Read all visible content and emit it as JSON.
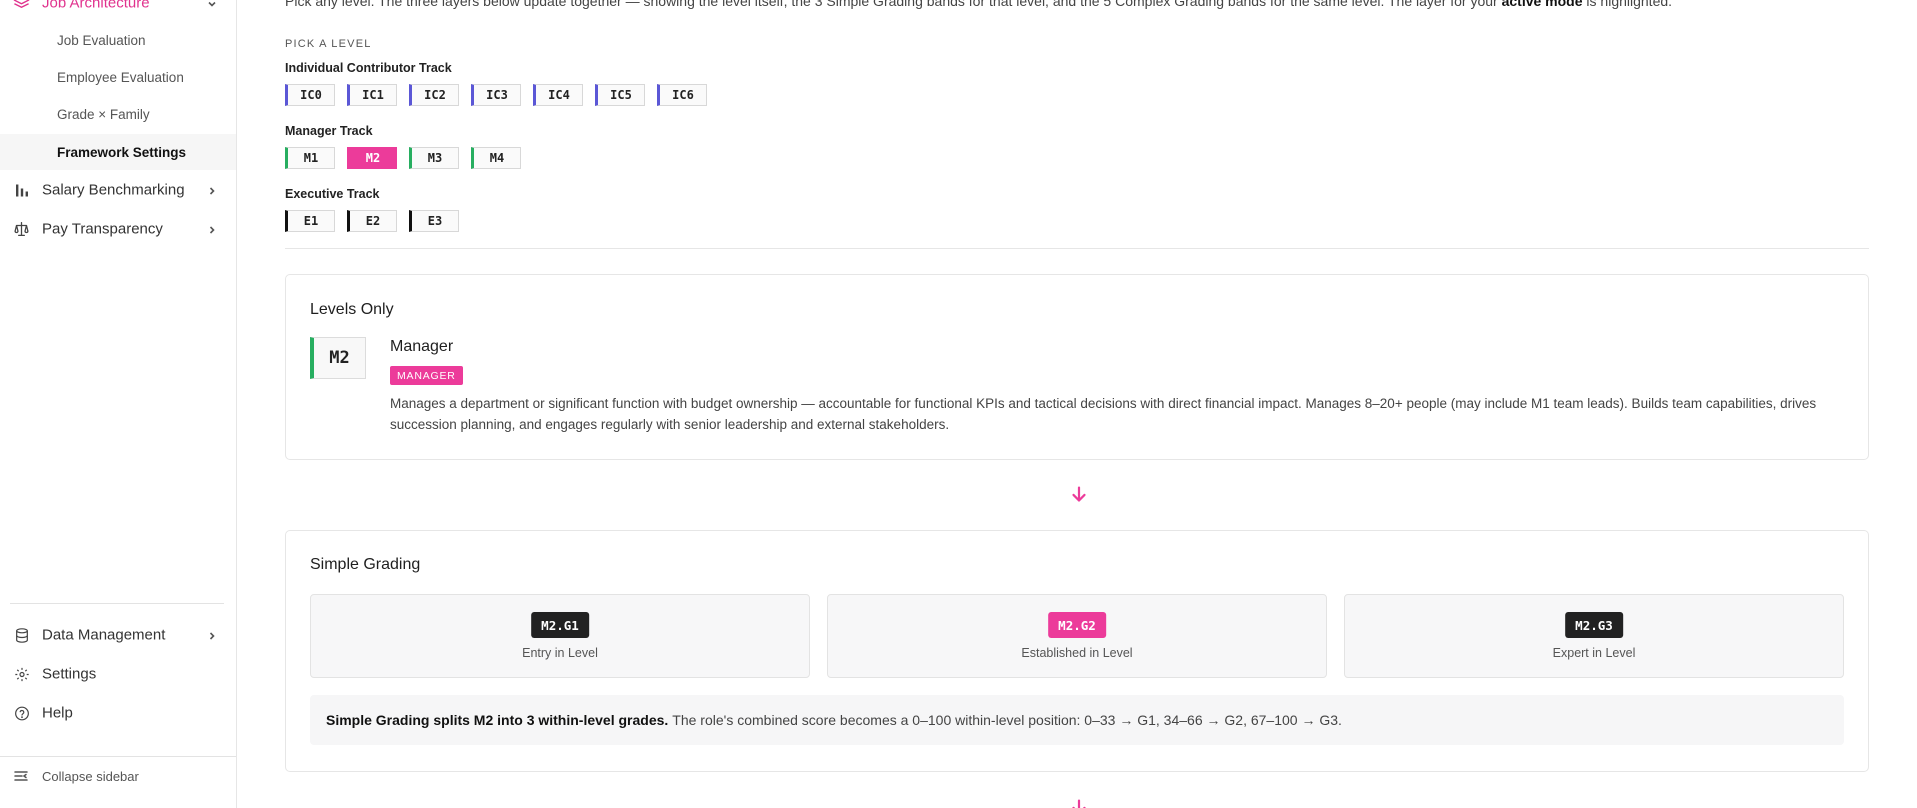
{
  "sidebar": {
    "job_architecture": "Job Architecture",
    "sub_items": [
      "Job Evaluation",
      "Employee Evaluation",
      "Grade × Family",
      "Framework Settings"
    ],
    "salary_benchmarking": "Salary Benchmarking",
    "pay_transparency": "Pay Transparency",
    "data_management": "Data Management",
    "settings": "Settings",
    "help": "Help",
    "collapse": "Collapse sidebar",
    "accent_color": "#e0338e"
  },
  "main": {
    "intro_start": "Pick any level. The three layers below update together — showing the level itself, the 3 Simple Grading bands for that level, and the 5 Complex Grading bands for the same level. The layer for your",
    "intro_bold": "active mode",
    "intro_end": "is highlighted.",
    "pick_label": "PICK A LEVEL",
    "tracks": {
      "ic": {
        "label": "Individual Contributor Track",
        "levels": [
          "IC0",
          "IC1",
          "IC2",
          "IC3",
          "IC4",
          "IC5",
          "IC6"
        ],
        "color": "#5b57d6"
      },
      "manager": {
        "label": "Manager Track",
        "levels": [
          "M1",
          "M2",
          "M3",
          "M4"
        ],
        "selected": "M2",
        "color": "#27ae60"
      },
      "executive": {
        "label": "Executive Track",
        "levels": [
          "E1",
          "E2",
          "E3"
        ],
        "color": "#111111"
      }
    },
    "levels_only": {
      "title": "Levels Only",
      "code": "M2",
      "name": "Manager",
      "tag": "MANAGER",
      "description": "Manages a department or significant function with budget ownership — accountable for functional KPIs and tactical decisions with direct financial impact. Manages 8–20+ people (may include M1 team leads). Builds team capabilities, drives succession planning, and engages regularly with senior leadership and external stakeholders."
    },
    "simple_grading": {
      "title": "Simple Grading",
      "grades": [
        {
          "code": "M2.G1",
          "label": "Entry in Level"
        },
        {
          "code": "M2.G2",
          "label": "Established in Level",
          "selected": true
        },
        {
          "code": "M2.G3",
          "label": "Expert in Level"
        }
      ],
      "note_bold": "Simple Grading splits M2 into 3 within-level grades.",
      "note_text": "The role's combined score becomes a 0–100 within-level position: 0–33 → G1, 34–66 → G2, 67–100 → G3."
    },
    "highlight_color": "#ec3b9a"
  }
}
